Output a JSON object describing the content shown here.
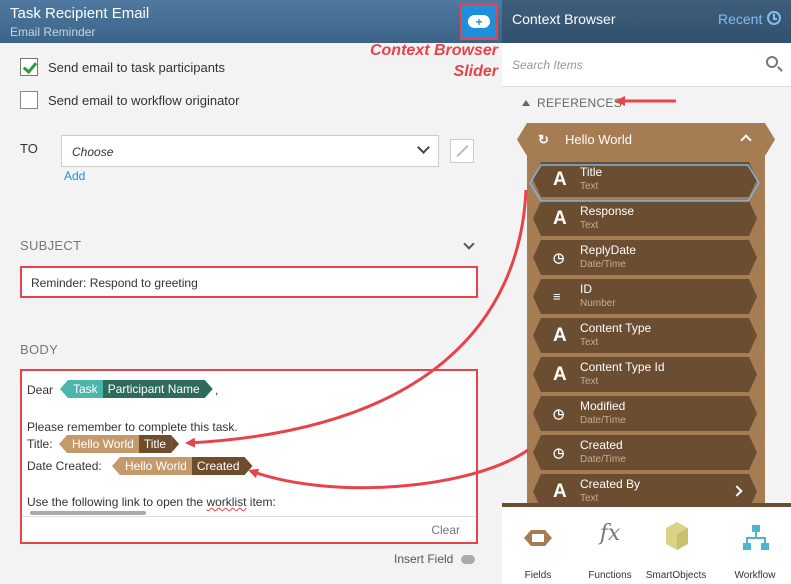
{
  "left_panel": {
    "title": "Task Recipient Email",
    "subtitle": "Email Reminder",
    "send_participants_label": "Send email to task participants",
    "send_participants_checked": true,
    "send_originator_label": "Send email to workflow originator",
    "send_originator_checked": false,
    "to_label": "TO",
    "to_value": "Choose",
    "add_link": "Add",
    "subject_label": "SUBJECT",
    "subject_value": "Reminder: Respond to greeting",
    "body_label": "BODY",
    "body": {
      "dear": "Dear",
      "tag_task_1": "Task",
      "tag_task_2": "Participant Name",
      "comma": ",",
      "reminder": "Please remember to complete this task.",
      "title_label": "Title:",
      "tag_title_1": "Hello World",
      "tag_title_2": "Title",
      "date_label": "Date Created:",
      "tag_date_1": "Hello World",
      "tag_date_2": "Created",
      "link_prefix": "Use the following link to open the ",
      "link_word": "worklist",
      "link_suffix": " item:",
      "clear": "Clear"
    },
    "insert_field": "Insert Field"
  },
  "annotation": {
    "line1": "Context Browser",
    "line2": "Slider"
  },
  "context_browser": {
    "title": "Context Browser",
    "recent": "Recent",
    "search_placeholder": "Search Items",
    "references_label": "REFERENCES",
    "group_title": "Hello World",
    "items": [
      {
        "name": "Title",
        "type": "Text",
        "icon": "A"
      },
      {
        "name": "Response",
        "type": "Text",
        "icon": "A"
      },
      {
        "name": "ReplyDate",
        "type": "Date/Time",
        "icon": "date"
      },
      {
        "name": "ID",
        "type": "Number",
        "icon": "num"
      },
      {
        "name": "Content Type",
        "type": "Text",
        "icon": "A"
      },
      {
        "name": "Content Type Id",
        "type": "Text",
        "icon": "A"
      },
      {
        "name": "Modified",
        "type": "Date/Time",
        "icon": "date"
      },
      {
        "name": "Created",
        "type": "Date/Time",
        "icon": "date"
      },
      {
        "name": "Created By",
        "type": "Text",
        "icon": "A"
      }
    ],
    "tabs": [
      "Fields",
      "Functions",
      "SmartObjects",
      "Workflow"
    ],
    "fx_glyph": "fx"
  },
  "colors": {
    "header_blue": "#4f79a0",
    "accent_blue": "#1e8fd8",
    "annotation_red": "#e8424a",
    "tree_brown": "#a67c52",
    "item_brown": "#6b4e31",
    "tag_teal": "#4db6ac"
  }
}
